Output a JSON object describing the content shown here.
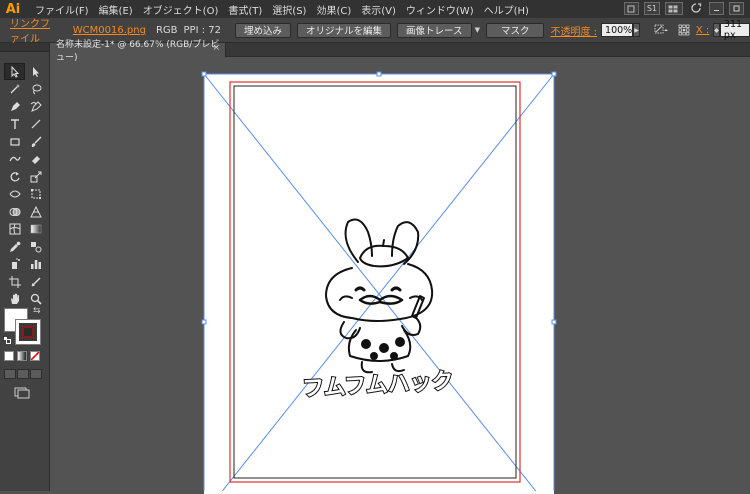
{
  "app": {
    "logo": "Ai"
  },
  "menu": [
    {
      "label": "ファイル(F)"
    },
    {
      "label": "編集(E)"
    },
    {
      "label": "オブジェクト(O)"
    },
    {
      "label": "書式(T)"
    },
    {
      "label": "選択(S)"
    },
    {
      "label": "効果(C)"
    },
    {
      "label": "表示(V)"
    },
    {
      "label": "ウィンドウ(W)"
    },
    {
      "label": "ヘルプ(H)"
    }
  ],
  "menubar_right": {
    "workspace_badge": "S1"
  },
  "controlbar": {
    "link_label": "リンクファイル",
    "file_name": "WCM0016.png",
    "color_mode": "RGB",
    "ppi": "PPI : 72",
    "embed_button": "埋め込み",
    "edit_original_button": "オリジナルを編集",
    "image_trace_button": "画像トレース",
    "mask_button": "マスク",
    "opacity_label": "不透明度 :",
    "opacity_value": "100%",
    "x_label": "X :",
    "x_value": "311 px"
  },
  "document": {
    "tab_title": "名称未設定-1* @ 66.67% (RGB/プレビュー)",
    "tab_close": "×"
  },
  "artwork": {
    "title_text": "フムフムハック"
  },
  "colors": {
    "accent_orange": "#f08a24",
    "selection_blue": "#5b8ee6",
    "bleed_red": "#e03030"
  },
  "icons": {
    "tools": [
      "selection-arrow",
      "direct-selection-arrow",
      "magic-wand",
      "lasso",
      "pen",
      "curvature",
      "type",
      "line-segment",
      "rectangle",
      "paintbrush",
      "shaper",
      "eraser",
      "rotate",
      "scale",
      "width",
      "free-transform",
      "shape-builder",
      "perspective-grid",
      "mesh",
      "gradient",
      "eyedropper",
      "blend",
      "symbol-sprayer",
      "column-graph",
      "artboard",
      "slice",
      "hand",
      "zoom"
    ]
  }
}
